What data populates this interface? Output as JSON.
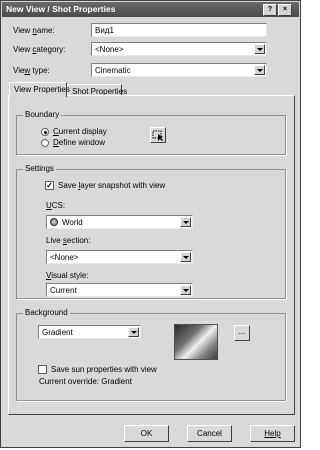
{
  "window": {
    "title": "New View / Shot Properties"
  },
  "fields": {
    "view_name": {
      "label_pre": "View ",
      "label_u": "n",
      "label_post": "ame:",
      "value": "Вид1"
    },
    "view_category": {
      "label_pre": "View ",
      "label_u": "c",
      "label_post": "ategory:",
      "value": "<None>"
    },
    "view_type": {
      "label_pre": "Vie",
      "label_u": "w",
      "label_post": " type:",
      "value": "Cinematic"
    }
  },
  "tabs": [
    {
      "label": "View Properties"
    },
    {
      "label": "Shot Properties"
    }
  ],
  "boundary": {
    "title": "Boundary",
    "current_display": {
      "u": "C",
      "rest": "urrent display"
    },
    "define_window": {
      "u": "D",
      "rest": "efine window"
    },
    "selected": "current_display"
  },
  "settings": {
    "title": "Settings",
    "save_snapshot": {
      "pre": "Save ",
      "u": "l",
      "post": "ayer snapshot with view",
      "checked": true
    },
    "ucs": {
      "label_u": "U",
      "label_rest": "CS:",
      "value": "World"
    },
    "live_section": {
      "label_pre": "Live ",
      "label_u": "s",
      "label_post": "ection:",
      "value": "<None>"
    },
    "visual_style": {
      "label_u": "V",
      "label_rest": "isual style:",
      "value": "Current"
    }
  },
  "background": {
    "title": "Background",
    "type": "Gradient",
    "browse_label": "...",
    "save_sun": {
      "label": "Save sun properties with view",
      "checked": false
    },
    "current_override": "Current override: Gradient"
  },
  "buttons": {
    "ok": "OK",
    "cancel": "Cancel",
    "help": "Help"
  },
  "titlebar_buttons": {
    "help": "?",
    "close": "×"
  }
}
